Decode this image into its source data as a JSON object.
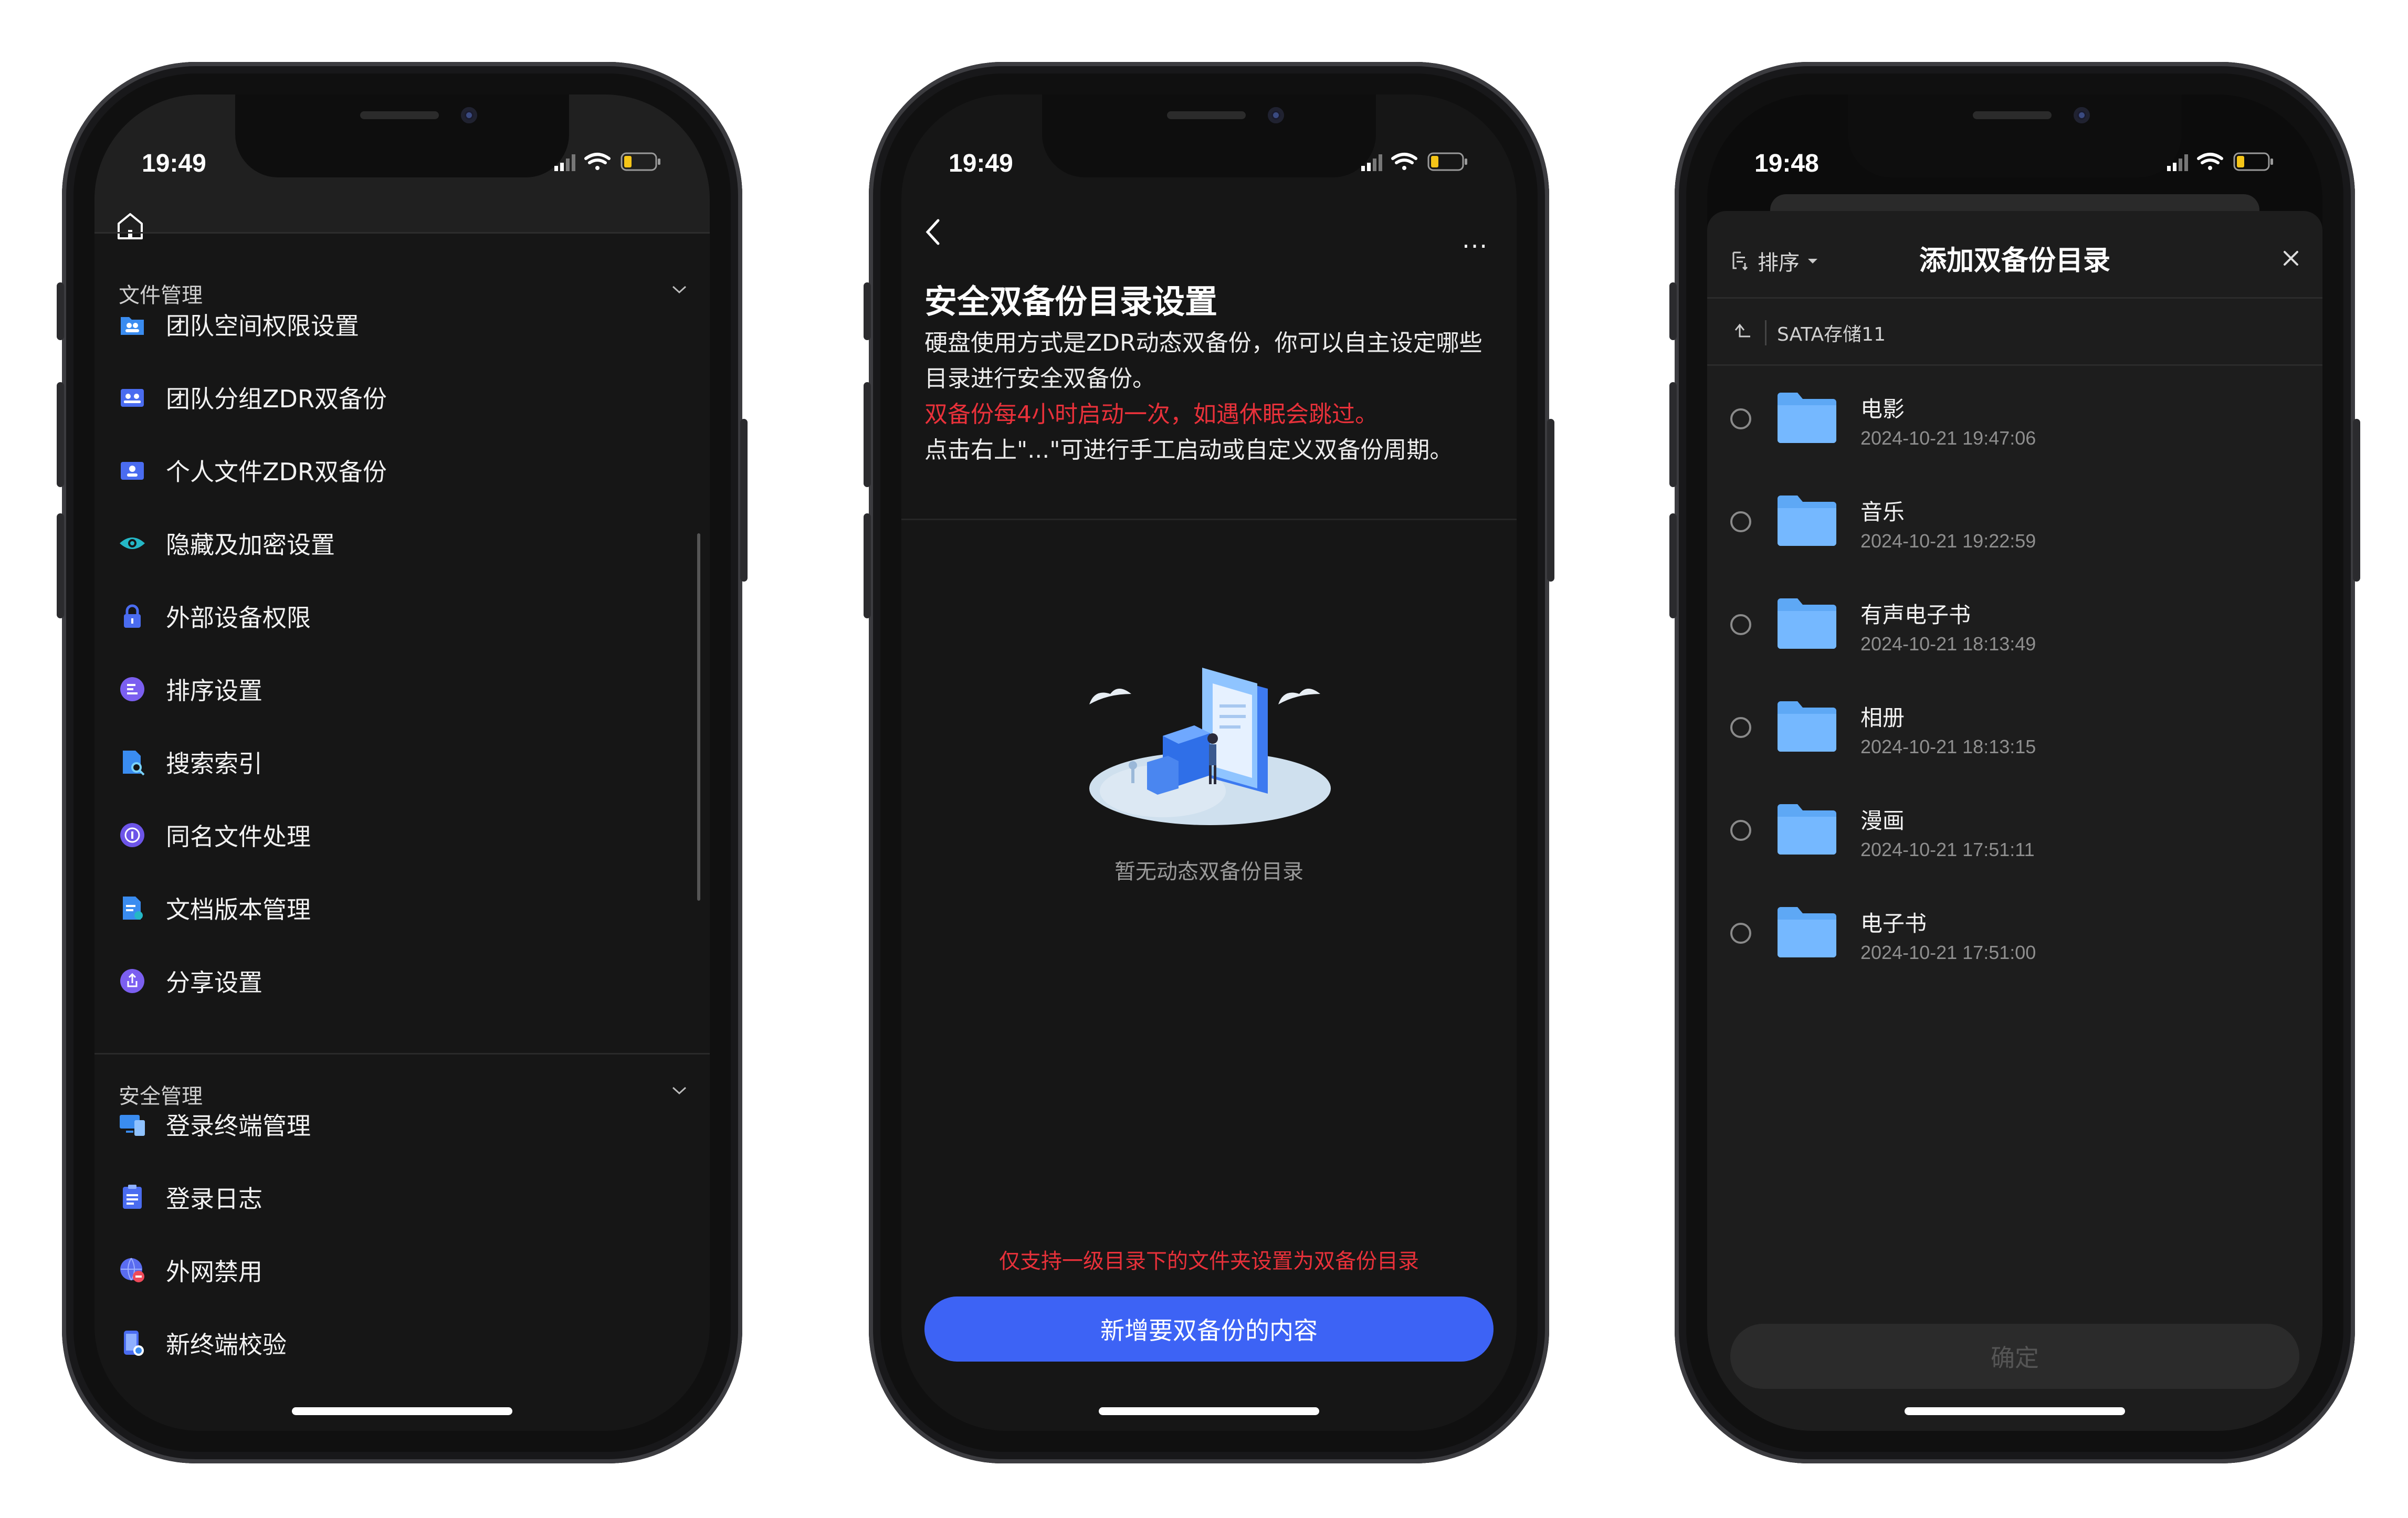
{
  "phone1": {
    "time": "19:49",
    "sections": [
      {
        "title": "文件管理",
        "items": [
          {
            "label": "团队空间权限设置",
            "icon": "team-folder-icon"
          },
          {
            "label": "团队分组ZDR双备份",
            "icon": "group-backup-icon"
          },
          {
            "label": "个人文件ZDR双备份",
            "icon": "personal-backup-icon"
          },
          {
            "label": "隐藏及加密设置",
            "icon": "eye-icon"
          },
          {
            "label": "外部设备权限",
            "icon": "lock-icon"
          },
          {
            "label": "排序设置",
            "icon": "sort-icon"
          },
          {
            "label": "搜索索引",
            "icon": "search-doc-icon"
          },
          {
            "label": "同名文件处理",
            "icon": "duplicate-icon"
          },
          {
            "label": "文档版本管理",
            "icon": "version-icon"
          },
          {
            "label": "分享设置",
            "icon": "share-icon"
          }
        ]
      },
      {
        "title": "安全管理",
        "items": [
          {
            "label": "登录终端管理",
            "icon": "devices-icon"
          },
          {
            "label": "登录日志",
            "icon": "log-icon"
          },
          {
            "label": "外网禁用",
            "icon": "globe-block-icon"
          },
          {
            "label": "新终端校验",
            "icon": "phone-check-icon"
          }
        ]
      }
    ]
  },
  "phone2": {
    "time": "19:49",
    "title": "安全双备份目录设置",
    "desc_line1": "硬盘使用方式是ZDR动态双备份，你可以自主设定哪些目录进行安全双备份。",
    "desc_red": "双备份每4小时启动一次，如遇休眠会跳过。",
    "desc_line3": "点击右上\"...\"可进行手工启动或自定义双备份周期。",
    "more_label": "···",
    "empty_text": "暂无动态双备份目录",
    "note": "仅支持一级目录下的文件夹设置为双备份目录",
    "add_button": "新增要双备份的内容"
  },
  "phone3": {
    "time": "19:48",
    "sort_label": "排序",
    "title": "添加双备份目录",
    "path": "SATA存储11",
    "folders": [
      {
        "name": "电影",
        "date": "2024-10-21 19:47:06"
      },
      {
        "name": "音乐",
        "date": "2024-10-21 19:22:59"
      },
      {
        "name": "有声电子书",
        "date": "2024-10-21 18:13:49"
      },
      {
        "name": "相册",
        "date": "2024-10-21 18:13:15"
      },
      {
        "name": "漫画",
        "date": "2024-10-21 17:51:11"
      },
      {
        "name": "电子书",
        "date": "2024-10-21 17:51:00"
      }
    ],
    "confirm": "确定"
  },
  "colors": {
    "accent": "#3d63f5",
    "warning_red": "#e8313a",
    "folder_blue": "#6eb4ff",
    "battery_yellow": "#f5c518"
  }
}
